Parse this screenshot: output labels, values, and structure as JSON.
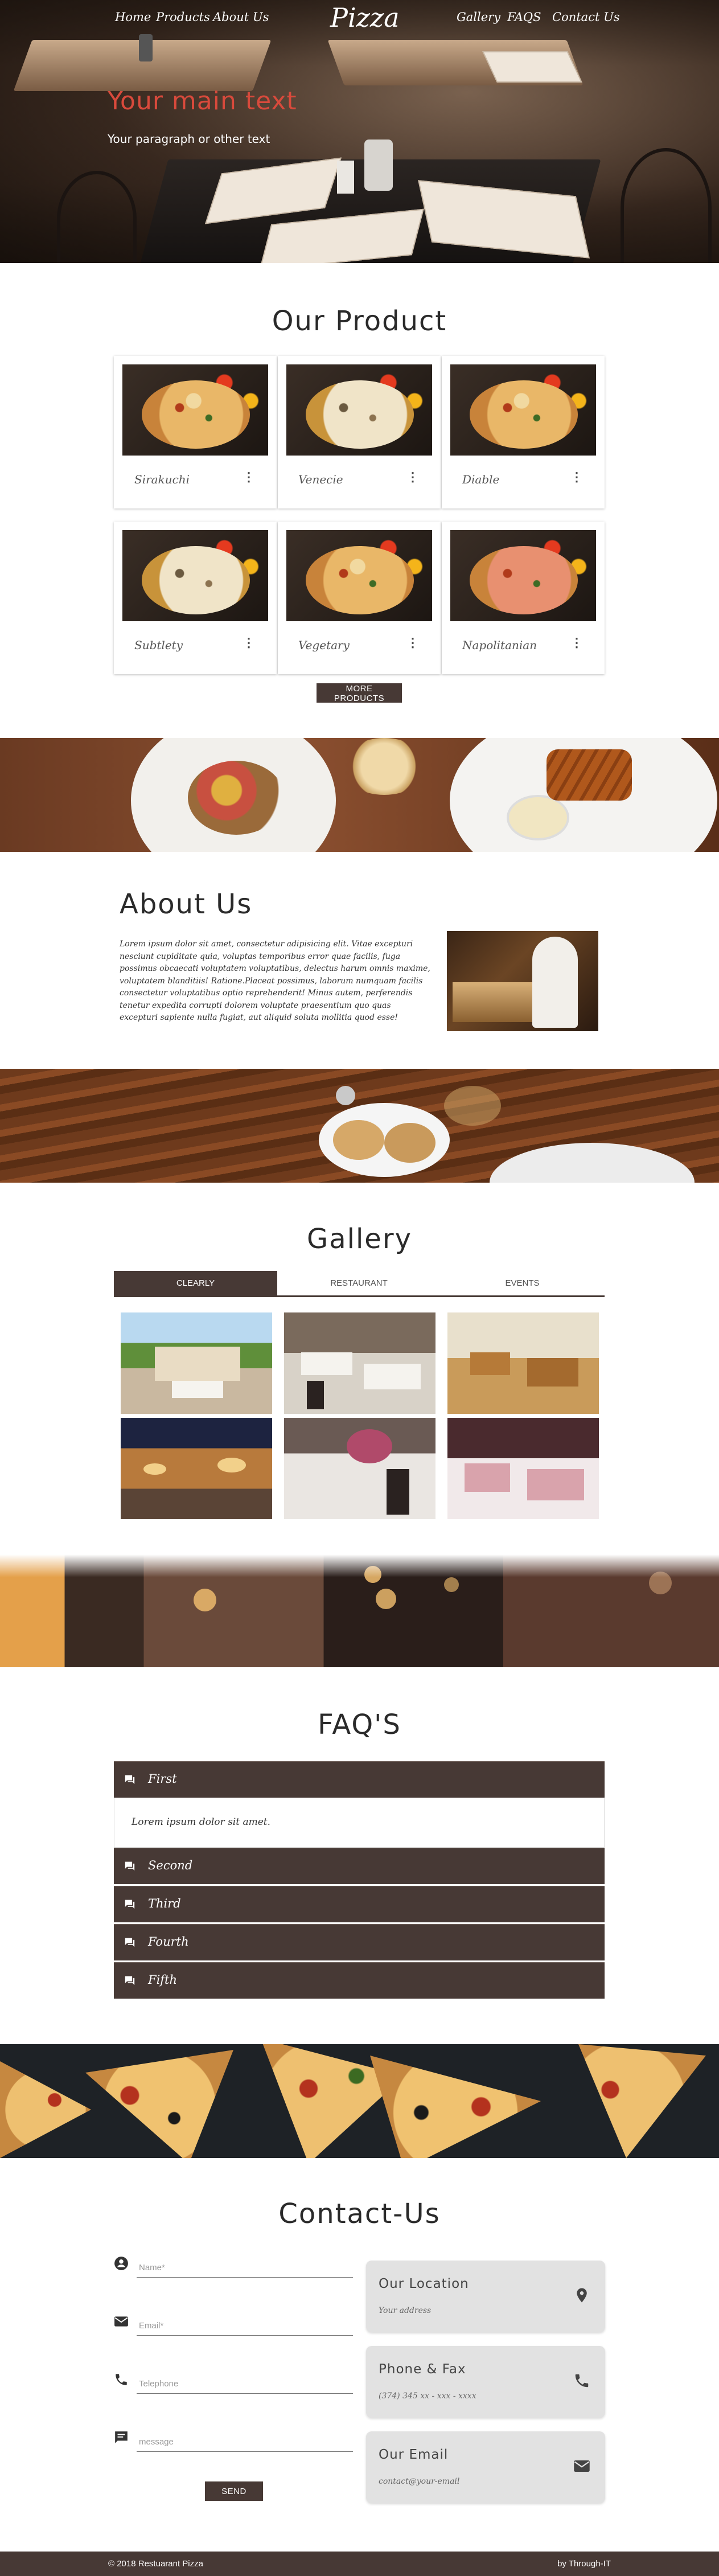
{
  "nav": {
    "brand": "Pizza",
    "left": [
      "Home",
      "Products",
      "About Us"
    ],
    "right": [
      "Gallery",
      "FAQS",
      "Contact Us"
    ]
  },
  "hero": {
    "heading": "Your main text",
    "paragraph": "Your paragraph or other text"
  },
  "products": {
    "title": "Our Product",
    "items": [
      {
        "name": "Sirakuchi",
        "style": "normal"
      },
      {
        "name": "Venecie",
        "style": "white"
      },
      {
        "name": "Diable",
        "style": "normal"
      },
      {
        "name": "Subtlety",
        "style": "white"
      },
      {
        "name": "Vegetary",
        "style": "normal"
      },
      {
        "name": "Napolitanian",
        "style": "red"
      }
    ],
    "more_icon": "more-vert-icon",
    "button": "MORE PRODUCTS"
  },
  "about": {
    "title": "About Us",
    "text": "Lorem ipsum dolor sit amet, consectetur adipisicing elit. Vitae excepturi nesciunt cupiditate quia, voluptas temporibus error quae facilis, fuga possimus obcaecati voluptatem voluptatibus, delectus harum omnis maxime, voluptatem blanditiis! Ratione.Placeat possimus, laborum numquam facilis consectetur voluptatibus optio reprehenderit! Minus autem, perferendis tenetur expedita corrupti dolorem voluptate praesentium quo quas excepturi sapiente nulla fugiat, aut aliquid soluta mollitia quod esse!"
  },
  "gallery": {
    "title": "Gallery",
    "tabs": [
      "CLEARLY",
      "RESTAURANT",
      "EVENTS"
    ],
    "active_tab": "CLEARLY"
  },
  "faq": {
    "title": "FAQ'S",
    "items": [
      {
        "label": "First",
        "expanded": true,
        "answer": "Lorem ipsum dolor sit amet."
      },
      {
        "label": "Second",
        "expanded": false
      },
      {
        "label": "Third",
        "expanded": false
      },
      {
        "label": "Fourth",
        "expanded": false
      },
      {
        "label": "Fifth",
        "expanded": false
      }
    ],
    "icon": "question-answer-icon"
  },
  "contact": {
    "title": "Contact-Us",
    "fields": [
      {
        "placeholder": "Name*",
        "icon": "person-icon"
      },
      {
        "placeholder": "Email*",
        "icon": "mail-icon"
      },
      {
        "placeholder": "Telephone",
        "icon": "phone-icon"
      },
      {
        "placeholder": "message",
        "icon": "chat-icon"
      }
    ],
    "send": "SEND",
    "cards": [
      {
        "title": "Our Location",
        "value": "Your address",
        "icon": "location-pin-icon"
      },
      {
        "title": "Phone & Fax",
        "value": "(374) 345 xx - xxx - xxxx",
        "icon": "phone-icon"
      },
      {
        "title": "Our Email",
        "value": "contact@your-email",
        "icon": "mail-icon"
      }
    ]
  },
  "footer": {
    "copyright": "© 2018 Restuarant Pizza",
    "credit": "by Through-IT"
  },
  "colors": {
    "primary": "#473935",
    "hero_heading": "#d94a3c",
    "card_background": "#e2e2e2"
  }
}
